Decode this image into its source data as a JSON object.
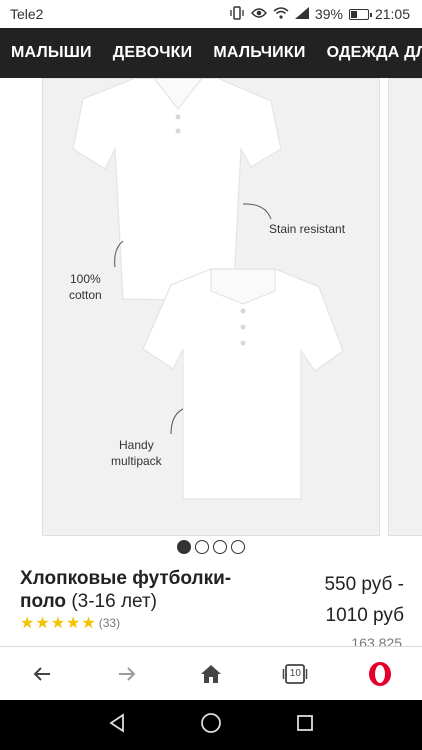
{
  "status_bar": {
    "carrier": "Tele2",
    "battery": "39%",
    "battery_level": 0.39,
    "time": "21:05"
  },
  "category_nav": {
    "items": [
      "МАЛЫШИ",
      "ДЕВОЧКИ",
      "МАЛЬЧИКИ",
      "ОДЕЖДА ДЛ"
    ]
  },
  "gallery": {
    "annotations": {
      "stain": "Stain resistant",
      "cotton_line1": "100%",
      "cotton_line2": "cotton",
      "handy_line1": "Handy",
      "handy_line2": "multipack"
    },
    "page_count": 4,
    "active_page": 1
  },
  "product": {
    "title_bold": "Хлопковые футболки-поло",
    "title_rest": " (3-16 лет)",
    "price_line1": "550 руб -",
    "price_line2": "1010 руб",
    "rating": 5,
    "reviews": "(33)",
    "partial_text": "163 825"
  },
  "toolbar": {
    "tabs_count": "10"
  },
  "colors": {
    "nav_bg": "#222222",
    "star": "#f2c300",
    "opera_red": "#e3002b"
  }
}
